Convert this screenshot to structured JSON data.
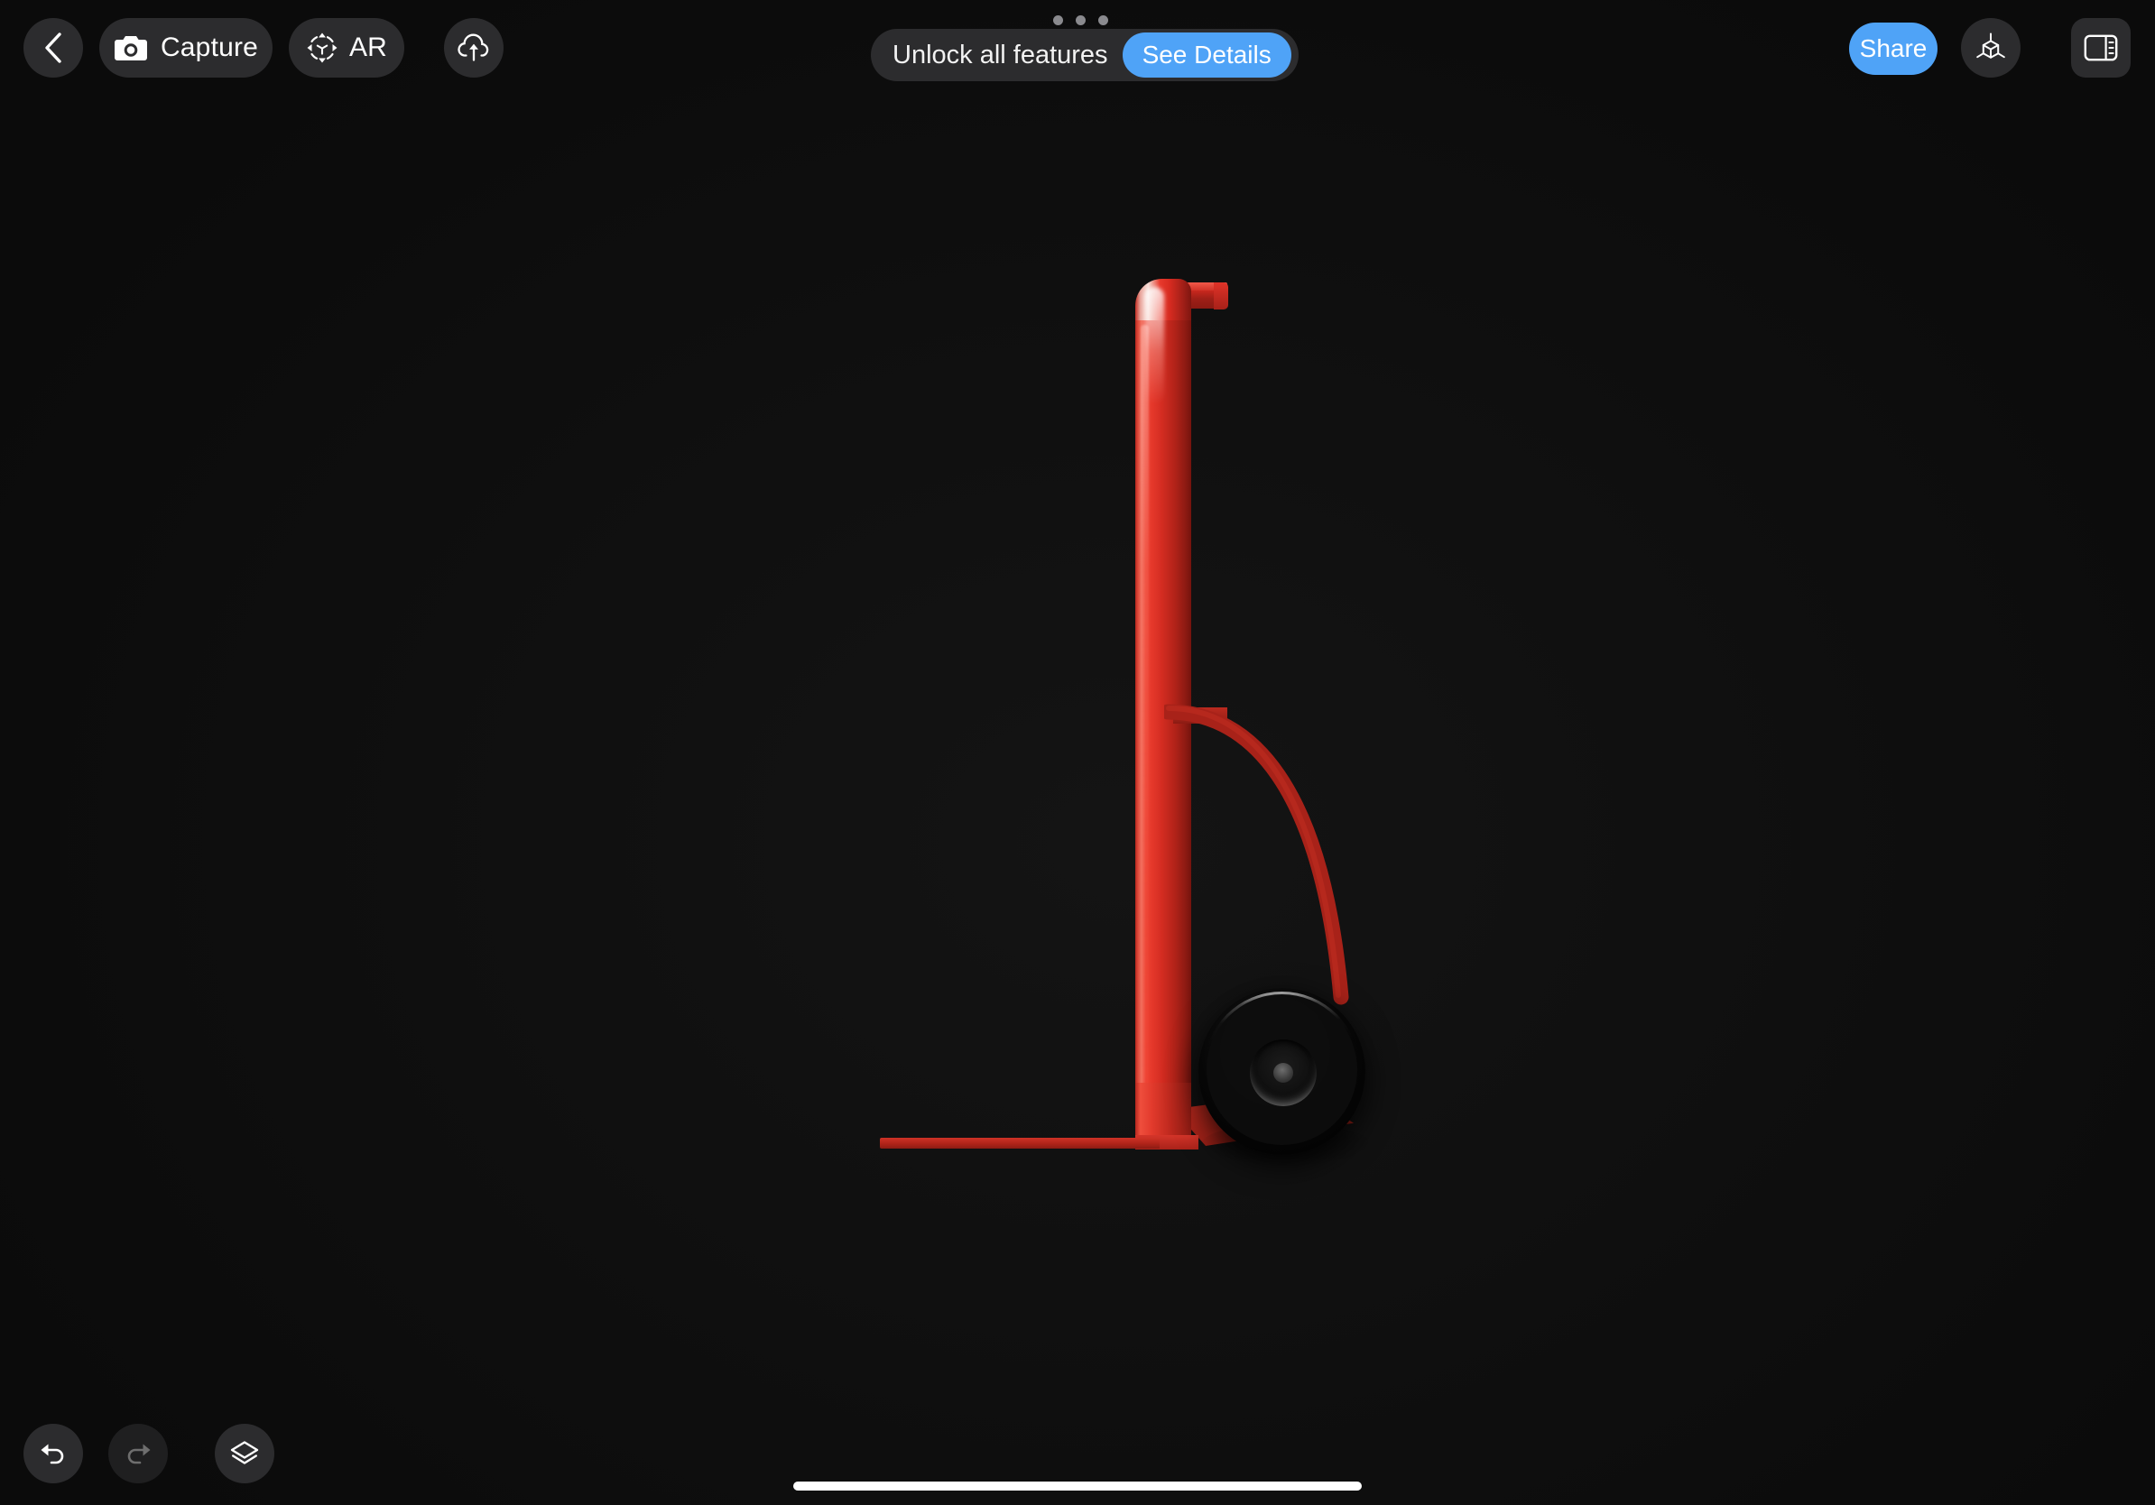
{
  "app": {
    "background_color": "#0d0d0d",
    "accent_color": "#4fa3f7",
    "toolbar_pill_color": "#2c2c2e"
  },
  "toolbar": {
    "back": {
      "label": "",
      "icon": "chevron-left-icon"
    },
    "capture": {
      "label": "Capture",
      "icon": "camera-icon"
    },
    "ar": {
      "label": "AR",
      "icon": "ar-cube-icon"
    },
    "upload": {
      "label": "",
      "icon": "cloud-upload-icon"
    }
  },
  "page_indicator": {
    "count": 3,
    "active_index": 0
  },
  "promo": {
    "text": "Unlock all features",
    "cta_label": "See Details",
    "cta_color": "#4fa3f7"
  },
  "right_controls": {
    "share": {
      "label": "Share",
      "color": "#4fa3f7"
    },
    "model_view": {
      "label": "",
      "icon": "cube-axes-icon"
    },
    "panel": {
      "label": "",
      "icon": "sidebar-panel-icon"
    }
  },
  "bottom_controls": {
    "undo": {
      "label": "",
      "icon": "undo-arrow-icon",
      "enabled": true
    },
    "redo": {
      "label": "",
      "icon": "redo-arrow-icon",
      "enabled": false
    },
    "layers": {
      "label": "",
      "icon": "layers-stack-icon",
      "enabled": true
    }
  },
  "model": {
    "name": "hand-truck-dolly",
    "frame_color": "#d6332a",
    "frame_shadow_color": "#8c1b13",
    "wheel_color": "#0a0a0a",
    "wheel_hub_color": "#5a5a5a"
  },
  "system": {
    "home_indicator": true
  }
}
